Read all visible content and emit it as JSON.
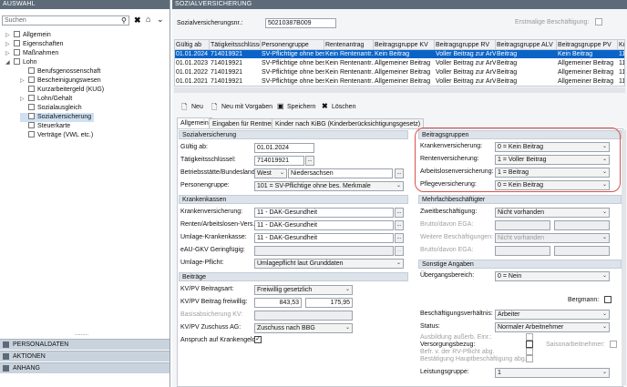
{
  "left": {
    "header": "AUSWAHL",
    "search_placeholder": "Suchen",
    "tree": [
      {
        "label": "Allgemein",
        "level": 0,
        "exp": "▷"
      },
      {
        "label": "Eigenschaften",
        "level": 0,
        "exp": "▷"
      },
      {
        "label": "Maßnahmen",
        "level": 0,
        "exp": "▷"
      },
      {
        "label": "Lohn",
        "level": 0,
        "exp": "◢"
      },
      {
        "label": "Berufsgenossenschaft",
        "level": 1,
        "exp": ""
      },
      {
        "label": "Bescheinigungswesen",
        "level": 1,
        "exp": "▷"
      },
      {
        "label": "Kurzarbeitergeld (KUG)",
        "level": 1,
        "exp": ""
      },
      {
        "label": "Lohn/Gehalt",
        "level": 1,
        "exp": "▷"
      },
      {
        "label": "Sozialausgleich",
        "level": 1,
        "exp": ""
      },
      {
        "label": "Sozialversicherung",
        "level": 1,
        "exp": "",
        "selected": true
      },
      {
        "label": "Steuerkarte",
        "level": 1,
        "exp": ""
      },
      {
        "label": "Verträge (VWL etc.)",
        "level": 1,
        "exp": ""
      }
    ],
    "accordion": [
      "PERSONALDATEN",
      "AKTIONEN",
      "ANHANG"
    ]
  },
  "right": {
    "header": "SOZIALVERSICHERUNG",
    "svnr_label": "Sozialversicherungsnr.:",
    "svnr_value": "50210387B009",
    "erstmalig_label": "Erstmalige Beschäftigung:",
    "table": {
      "columns": [
        "Gültig ab",
        "Tätigkeitsschlüssel",
        "Personengruppe",
        "Rentenantrag",
        "Beitragsgruppe KV",
        "Beitragsgruppe RV",
        "Beitragsgruppe ALV",
        "Beitragsgruppe PV",
        "Kr"
      ],
      "rows": [
        [
          "01.01.2024",
          "714019921",
          "SV-Pflichtige ohne bes",
          "Kein Rentenantr...",
          "Kein Beitrag",
          "Voller Beitrag zur ArV",
          "Beitrag",
          "Kein Beitrag",
          "11"
        ],
        [
          "01.01.2023",
          "714019921",
          "SV-Pflichtige ohne bes",
          "Kein Rentenantr...",
          "Allgemeiner Beitrag",
          "Voller Beitrag zur ArV",
          "Beitrag",
          "Allgemeiner Beitrag",
          "11"
        ],
        [
          "01.01.2022",
          "714019921",
          "SV-Pflichtige ohne bes",
          "Kein Rentenantr...",
          "Allgemeiner Beitrag",
          "Voller Beitrag zur ArV",
          "Beitrag",
          "Allgemeiner Beitrag",
          "11"
        ],
        [
          "01.01.2021",
          "714019921",
          "SV-Pflichtige ohne bes",
          "Kein Rentenantr...",
          "Allgemeiner Beitrag",
          "Voller Beitrag zur ArV",
          "Beitrag",
          "Allgemeiner Beitrag",
          "11"
        ]
      ]
    },
    "toolbar": {
      "neu": "Neu",
      "neu_vorgaben": "Neu mit Vorgaben",
      "speichern": "Speichern",
      "loeschen": "Löschen"
    },
    "tabs": [
      "Allgemein",
      "Eingaben für Rentner",
      "Kinder nach KiBG (Kinderberücksichtigungsgesetz)"
    ],
    "sv": {
      "title": "Sozialversicherung",
      "gueltig_label": "Gültig ab:",
      "gueltig_value": "01.01.2024",
      "taetig_label": "Tätigkeitsschlüssel:",
      "taetig_value": "714019921",
      "betrieb_label": "Betriebsstätte/Bundesland:",
      "betrieb_value": "West",
      "bundesland_value": "Niedersachsen",
      "pg_label": "Personengruppe:",
      "pg_value": "101 = SV-Pflichtige ohne bes. Merkmale"
    },
    "kk": {
      "title": "Krankenkassen",
      "kv_label": "Krankenversicherung:",
      "kv_value": "11 - DAK-Gesundheit",
      "rv_label": "Renten/Arbeitslosen-Vers.:",
      "rv_value": "11 - DAK-Gesundheit",
      "um_label": "Umlage-Krankenkasse:",
      "um_value": "11 - DAK-Gesundheit",
      "egv_label": "eAU-GKV Geringfügig:",
      "upf_label": "Umlage-Pflicht:",
      "upf_value": "Umlagepflicht laut Grunddaten"
    },
    "beitraege": {
      "title": "Beiträge",
      "art_label": "KV/PV Beitragsart:",
      "art_value": "Freiwillig gesetzlich",
      "frei_label": "KV/PV Beitrag freiwillig:",
      "frei_kv": "843,53",
      "frei_pv": "175,95",
      "basis_label": "Basisabsicherung KV:",
      "zuschuss_label": "KV/PV Zuschuss AG:",
      "zuschuss_value": "Zuschuss nach BBG",
      "kg_label": "Anspruch auf Krankengeld:"
    },
    "bg": {
      "title": "Beitragsgruppen",
      "kv_label": "Krankenversicherung:",
      "kv_value": "0 = Kein Beitrag",
      "rv_label": "Rentenversicherung:",
      "rv_value": "1 = Voller Beitrag",
      "alv_label": "Arbeitslosenversicherung:",
      "alv_value": "1 = Beitrag",
      "pv_label": "Pflegeversicherung:",
      "pv_value": "0 = Kein Beitrag"
    },
    "mfb": {
      "title": "Mehrfachbeschäftigter",
      "zweit_label": "Zweitbeschäftigung:",
      "zweit_value": "Nicht vorhanden",
      "brutto1_label": "Brutto/davon EGA:",
      "weitere_label": "Weitere Beschäftigungen:",
      "weitere_value": "Nicht vorhanden",
      "brutto2_label": "Brutto/davon EGA:"
    },
    "sonst": {
      "title": "Sonstige Angaben",
      "ueber_label": "Übergangsbereich:",
      "ueber_value": "0 = Nein",
      "bergmann_label": "Bergmann:",
      "bv_label": "Beschäftigungsverhältnis:",
      "bv_value": "Arbeiter",
      "status_label": "Status:",
      "status_value": "Normaler Arbeitnehmer",
      "ausb_label": "Ausbildung außerb. Einr.:",
      "versorg_label": "Versorgungsbezug:",
      "saison_label": "Saisonarbeitnehmer:",
      "befr_label": "Befr. v. der RV-Pflicht abg.",
      "bestaet_label": "Bestätigung Hauptbeschäftigung abg.",
      "lg_label": "Leistungsgruppe:",
      "lg_value": "1"
    }
  }
}
